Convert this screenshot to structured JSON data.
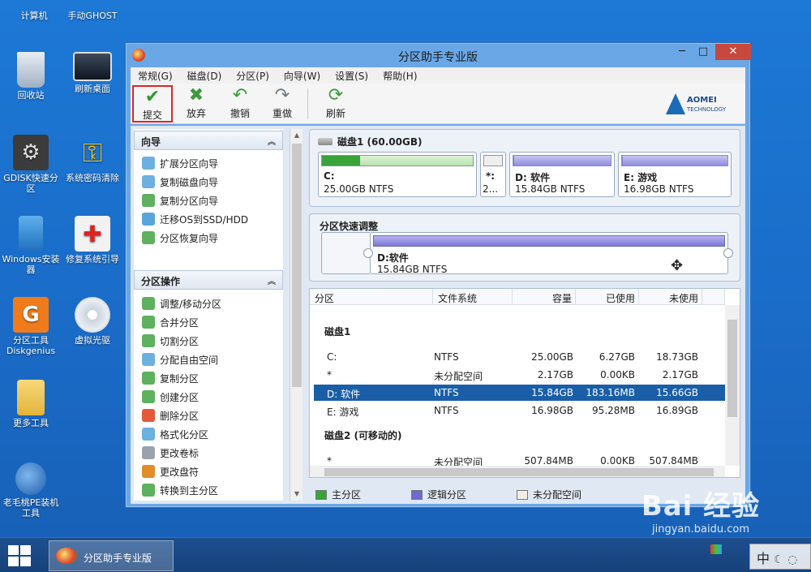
{
  "desktop": {
    "icons": [
      {
        "label": "计算机"
      },
      {
        "label": "手动GHOST"
      },
      {
        "label": "回收站"
      },
      {
        "label": "刷新桌面"
      },
      {
        "label": "GDISK快速分区"
      },
      {
        "label": "系统密码清除"
      },
      {
        "label": "Windows安装器"
      },
      {
        "label": "修复系统引导"
      },
      {
        "label": "分区工具Diskgenius"
      },
      {
        "label": "虚拟光驱"
      },
      {
        "label": "更多工具"
      },
      {
        "label": "老毛桃PE装机工具"
      }
    ]
  },
  "window": {
    "title": "分区助手专业版",
    "controls": {
      "minimize": "─",
      "maximize": "□",
      "close": "✕"
    },
    "menu": [
      "常规(G)",
      "磁盘(D)",
      "分区(P)",
      "向导(W)",
      "设置(S)",
      "帮助(H)"
    ],
    "toolbar": {
      "commit": "提交",
      "discard": "放弃",
      "undo": "撤销",
      "redo": "重做",
      "refresh": "刷新"
    },
    "brand": {
      "name": "AOMEI",
      "sub": "TECHNOLOGY"
    }
  },
  "left_panel": {
    "wizard_title": "向导",
    "wizard_items": [
      "扩展分区向导",
      "复制磁盘向导",
      "复制分区向导",
      "迁移OS到SSD/HDD",
      "分区恢复向导"
    ],
    "ops_title": "分区操作",
    "ops_items": [
      "调整/移动分区",
      "合并分区",
      "切割分区",
      "分配自由空间",
      "复制分区",
      "创建分区",
      "删除分区",
      "格式化分区",
      "更改卷标",
      "更改盘符",
      "转换到主分区"
    ]
  },
  "disk": {
    "title": "磁盘1 (60.00GB)",
    "partitions": [
      {
        "label": "C:",
        "size": "25.00GB NTFS",
        "used_fraction": 0.25,
        "color": "#3aa33a"
      },
      {
        "label": "*:",
        "size": "2...",
        "used_fraction": 0,
        "color": "#e0e0e0"
      },
      {
        "label": "D: 软件",
        "size": "15.84GB NTFS",
        "used_fraction": 0.01,
        "color": "#7f7bd6"
      },
      {
        "label": "E: 游戏",
        "size": "16.98GB NTFS",
        "used_fraction": 0.01,
        "color": "#7f7bd6"
      }
    ]
  },
  "quick_adjust": {
    "title": "分区快速调整",
    "label": "D:软件",
    "size": "15.84GB NTFS"
  },
  "table": {
    "headers": [
      "分区",
      "文件系统",
      "容量",
      "已使用",
      "未使用"
    ],
    "disk1_title": "磁盘1",
    "disk1_rows": [
      {
        "name": "C:",
        "fs": "NTFS",
        "cap": "25.00GB",
        "used": "6.27GB",
        "free": "18.73GB"
      },
      {
        "name": "*",
        "fs": "未分配空间",
        "cap": "2.17GB",
        "used": "0.00KB",
        "free": "2.17GB"
      },
      {
        "name": "D: 软件",
        "fs": "NTFS",
        "cap": "15.84GB",
        "used": "183.16MB",
        "free": "15.66GB"
      },
      {
        "name": "E: 游戏",
        "fs": "NTFS",
        "cap": "16.98GB",
        "used": "95.28MB",
        "free": "16.89GB"
      }
    ],
    "disk2_title": "磁盘2 (可移动的)",
    "disk2_rows": [
      {
        "name": "*",
        "fs": "未分配空间",
        "cap": "507.84MB",
        "used": "0.00KB",
        "free": "507.84MB"
      }
    ]
  },
  "legend": [
    "主分区",
    "逻辑分区",
    "未分配空间"
  ],
  "legend_colors": {
    "primary": "#3aa33a",
    "logical": "#6d6ad0",
    "unallocated": "#f2ede6"
  },
  "taskbar": {
    "app_label": "分区助手专业版",
    "ime": "中"
  },
  "watermark": {
    "brand": "Bai 经验",
    "url": "jingyan.baidu.com"
  }
}
